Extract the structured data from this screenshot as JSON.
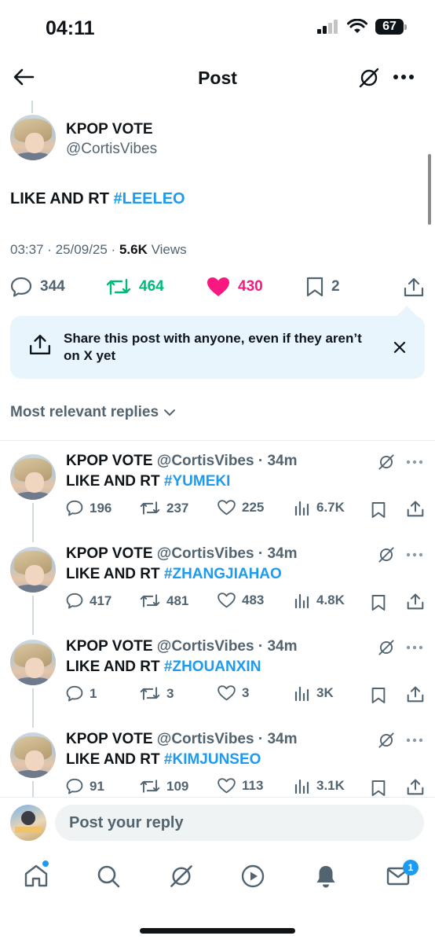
{
  "status_bar": {
    "time": "04:11",
    "battery": "67"
  },
  "header": {
    "title": "Post"
  },
  "post": {
    "author_name": "KPOP VOTE",
    "author_handle": "@CortisVibes",
    "text_prefix": "LIKE AND RT ",
    "hashtag": "#LEELEO",
    "timestamp": "03:37 · 25/09/25 · ",
    "views_count": "5.6K",
    "views_label": " Views",
    "replies": "344",
    "reposts": "464",
    "likes": "430",
    "bookmarks": "2"
  },
  "share_card": {
    "text": "Share this post with anyone, even if they aren’t on X yet"
  },
  "replies_sort": {
    "label": "Most relevant replies"
  },
  "replies": [
    {
      "name": "KPOP VOTE",
      "handle": "@CortisVibes",
      "time": "34m",
      "text_prefix": "LIKE AND RT ",
      "hashtag": "#YUMEKI",
      "replies": "196",
      "reposts": "237",
      "likes": "225",
      "views": "6.7K"
    },
    {
      "name": "KPOP VOTE",
      "handle": "@CortisVibes",
      "time": "34m",
      "text_prefix": "LIKE AND RT ",
      "hashtag": "#ZHANGJIAHAO",
      "replies": "417",
      "reposts": "481",
      "likes": "483",
      "views": "4.8K"
    },
    {
      "name": "KPOP VOTE",
      "handle": "@CortisVibes",
      "time": "34m",
      "text_prefix": "LIKE AND RT ",
      "hashtag": "#ZHOUANXIN",
      "replies": "1",
      "reposts": "3",
      "likes": "3",
      "views": "3K"
    },
    {
      "name": "KPOP VOTE",
      "handle": "@CortisVibes",
      "time": "34m",
      "text_prefix": "LIKE AND RT ",
      "hashtag": "#KIMJUNSEO",
      "replies": "91",
      "reposts": "109",
      "likes": "113",
      "views": "3.1K"
    }
  ],
  "composer": {
    "placeholder": "Post your reply"
  },
  "tab_bar": {
    "messages_badge": "1"
  },
  "colors": {
    "accent": "#1d9bf0",
    "repost_green": "#00ba7c",
    "like_pink": "#f91880",
    "share_bg": "#e8f5fd"
  }
}
